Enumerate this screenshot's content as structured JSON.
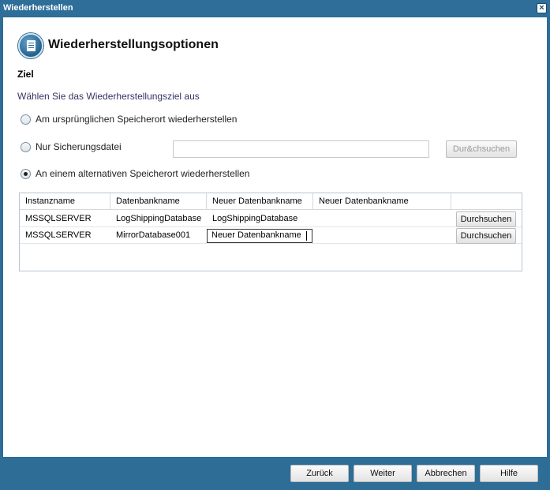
{
  "window": {
    "title": "Wiederherstellen"
  },
  "header": {
    "title": "Wiederherstellungsoptionen",
    "icon": "document-list-icon"
  },
  "section": {
    "title": "Ziel",
    "subtitle": "Wählen Sie das Wiederherstellungsziel aus"
  },
  "options": {
    "original": {
      "label": "Am ursprünglichen Speicherort wiederherstellen",
      "checked": false
    },
    "backup_only": {
      "label": "Nur Sicherungsdatei",
      "checked": false,
      "path_value": "",
      "browse_label": "Dur&chsuchen"
    },
    "alternate": {
      "label": "An einem alternativen Speicherort wiederherstellen",
      "checked": true
    }
  },
  "table": {
    "columns": [
      "Instanzname",
      "Datenbankname",
      "Neuer Datenbankname",
      "Neuer Datenbankname",
      ""
    ],
    "rows": [
      {
        "instance": "MSSQLSERVER",
        "database": "LogShippingDatabase",
        "new_name": "LogShippingDatabase",
        "button": "Durchsuchen"
      },
      {
        "instance": "MSSQLSERVER",
        "database": "MirrorDatabase001",
        "new_name": "Neuer Datenbankname",
        "button": "Durchsuchen",
        "editing": true
      }
    ]
  },
  "footer": {
    "back": "Zurück",
    "next": "Weiter",
    "cancel": "Abbrechen",
    "help": "Hilfe"
  },
  "colors": {
    "title_bar": "#2e6e99",
    "border": "#2d6d96",
    "accent": "#2b6a96"
  }
}
